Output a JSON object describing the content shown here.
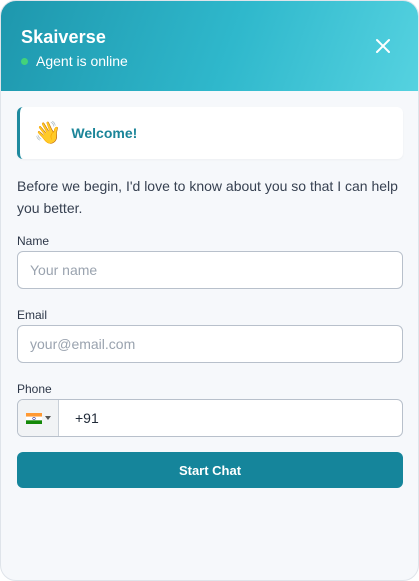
{
  "header": {
    "title": "Skaiverse",
    "status": "Agent is online"
  },
  "welcome": {
    "icon": "waving-hand-icon",
    "emoji": "👋",
    "title": "Welcome!"
  },
  "intro": "Before we begin, I'd love to know about you so that I can help you better.",
  "form": {
    "name": {
      "label": "Name",
      "value": "",
      "placeholder": "Your name"
    },
    "email": {
      "label": "Email",
      "value": "",
      "placeholder": "your@email.com"
    },
    "phone": {
      "label": "Phone",
      "country_flag": "india-flag-icon",
      "value": "+91"
    },
    "submit_label": "Start Chat"
  },
  "colors": {
    "header_gradient_start": "#1e97ad",
    "header_gradient_end": "#55d2e0",
    "accent": "#15859b",
    "online_dot": "#43d27a"
  }
}
